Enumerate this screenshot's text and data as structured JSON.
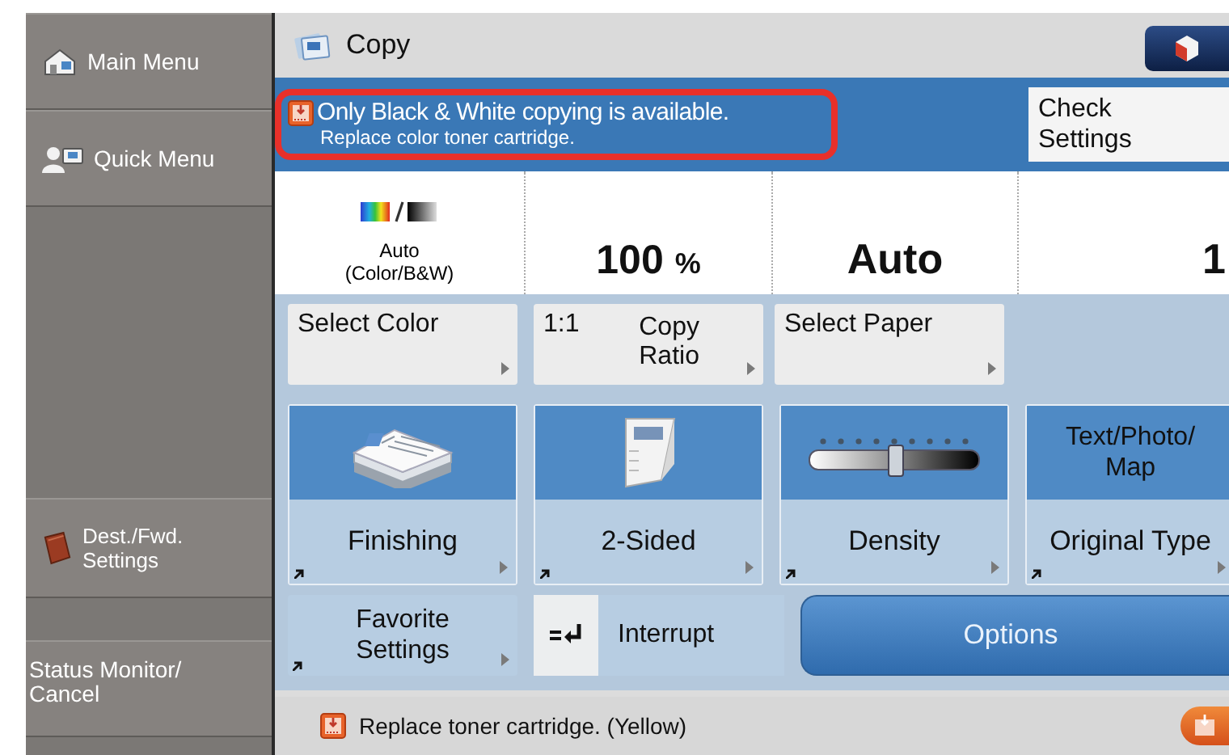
{
  "sidebar": {
    "items": [
      {
        "kind": "home",
        "label": "Main Menu"
      },
      {
        "kind": "quick",
        "label": "Quick Menu"
      },
      {
        "kind": "book",
        "label": "Dest./Fwd. Settings"
      },
      {
        "kind": "text",
        "label": "Status Monitor/ Cancel"
      }
    ]
  },
  "header": {
    "title": "Copy"
  },
  "alert": {
    "message": "Only Black & White copying is available.",
    "detail": "Replace color toner cartridge.",
    "highlighted": true,
    "button": "Check Settings"
  },
  "summary": {
    "color_mode": "Auto (Color/B&W)",
    "ratio": "100",
    "ratio_unit": "%",
    "paper": "Auto",
    "copies": "1"
  },
  "settings_buttons": [
    {
      "kind": "single",
      "label": "Select Color"
    },
    {
      "kind": "ratio",
      "label": "1:1",
      "sublabel": "Copy Ratio"
    },
    {
      "kind": "single",
      "label": "Select Paper"
    }
  ],
  "tiles": [
    {
      "kind": "finishing",
      "label": "Finishing"
    },
    {
      "kind": "two-sided",
      "label": "2-Sided"
    },
    {
      "kind": "density",
      "label": "Density",
      "level": 0.5
    },
    {
      "kind": "text",
      "value": "Text/Photo/ Map",
      "label": "Original Type"
    }
  ],
  "bottom": {
    "favorite": "Favorite Settings",
    "interrupt": "Interrupt",
    "options": "Options"
  },
  "status_bar": {
    "message": "Replace toner cartridge. (Yellow)"
  }
}
